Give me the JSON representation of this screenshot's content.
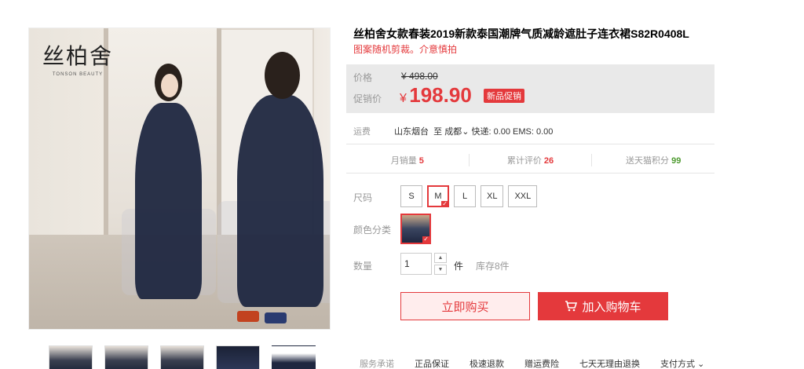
{
  "brand": {
    "logo_cn": "丝柏舍",
    "logo_en": "TONSON BEAUTY"
  },
  "product": {
    "title": "丝柏舍女款春装2019新款泰国潮牌气质减龄遮肚子连衣裙S82R0408L",
    "subtitle": "图案随机剪裁。介意慎拍"
  },
  "price": {
    "orig_label": "价格",
    "orig_value": "¥ 498.00",
    "promo_label": "促销价",
    "currency": "¥",
    "promo_value": "198.90",
    "promo_tag": "新品促销"
  },
  "shipping": {
    "label": "运费",
    "origin": "山东烟台",
    "to": "至",
    "dest": "成都",
    "fees": "快递: 0.00 EMS: 0.00"
  },
  "stats": {
    "monthly_sales_label": "月销量",
    "monthly_sales_value": "5",
    "reviews_label": "累计评价",
    "reviews_value": "26",
    "points_label": "送天猫积分",
    "points_value": "99"
  },
  "options": {
    "size_label": "尺码",
    "sizes": [
      "S",
      "M",
      "L",
      "XL",
      "XXL"
    ],
    "selected_size": "M",
    "color_label": "颜色分类",
    "qty_label": "数量",
    "qty_value": "1",
    "qty_unit": "件",
    "stock": "库存8件"
  },
  "actions": {
    "buy_now": "立即购买",
    "add_cart": "加入购物车"
  },
  "services": {
    "label": "服务承诺",
    "items": [
      "正品保证",
      "极速退款",
      "赠运费险",
      "七天无理由退换"
    ],
    "payment": "支付方式"
  },
  "colors": {
    "accent": "#e4393c",
    "green": "#4d9a2f",
    "price_bg": "#e9e9e9"
  }
}
